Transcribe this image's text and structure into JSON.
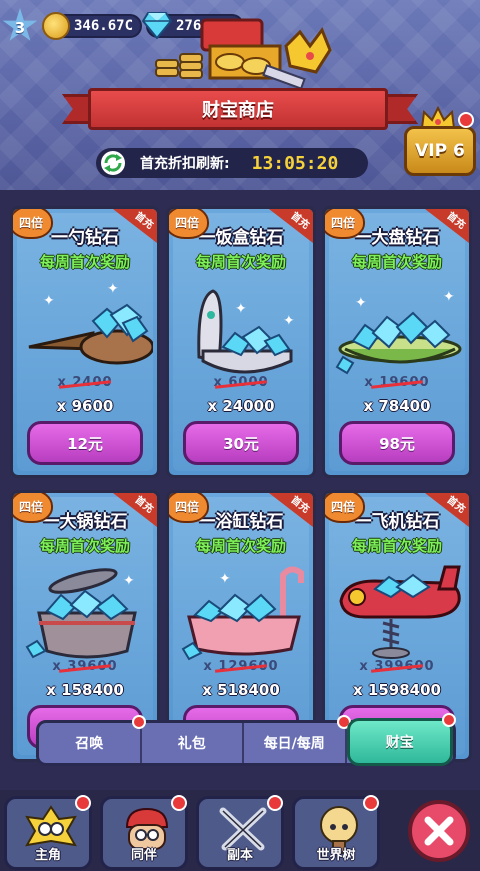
{
  "header": {
    "level": "3",
    "coins": "346.67C",
    "gems": "276092",
    "title": "财宝商店",
    "refresh_label": "首充折扣刷新:",
    "refresh_timer": "13:05:20",
    "vip": "VIP 6"
  },
  "cards": [
    {
      "badge": "四倍",
      "corner": "首充",
      "title": "一勺钻石",
      "subtitle": "每周首次奖励",
      "old": "x 2400",
      "amount": "x 9600",
      "price": "12元",
      "art": "spoon"
    },
    {
      "badge": "四倍",
      "corner": "首充",
      "title": "一饭盒钻石",
      "subtitle": "每周首次奖励",
      "old": "x 6000",
      "amount": "x 24000",
      "price": "30元",
      "art": "lunchbox"
    },
    {
      "badge": "四倍",
      "corner": "首充",
      "title": "一大盘钻石",
      "subtitle": "每周首次奖励",
      "old": "x 19600",
      "amount": "x 78400",
      "price": "98元",
      "art": "plate"
    },
    {
      "badge": "四倍",
      "corner": "首充",
      "title": "一大锅钻石",
      "subtitle": "每周首次奖励",
      "old": "x 39600",
      "amount": "x 158400",
      "price": "",
      "art": "pot"
    },
    {
      "badge": "四倍",
      "corner": "首充",
      "title": "一浴缸钻石",
      "subtitle": "每周首次奖励",
      "old": "x 129600",
      "amount": "x 518400",
      "price": "",
      "art": "bathtub"
    },
    {
      "badge": "四倍",
      "corner": "首充",
      "title": "一飞机钻石",
      "subtitle": "每周首次奖励",
      "old": "x 399600",
      "amount": "x 1598400",
      "price": "",
      "art": "airplane"
    }
  ],
  "tabs": [
    {
      "label": "召唤",
      "active": false
    },
    {
      "label": "礼包",
      "active": false
    },
    {
      "label": "每日/每周",
      "active": false
    },
    {
      "label": "财宝",
      "active": true
    }
  ],
  "nav": [
    {
      "label": "主角",
      "icon": "hero-icon"
    },
    {
      "label": "同伴",
      "icon": "partner-icon"
    },
    {
      "label": "副本",
      "icon": "dungeon-swords-icon"
    },
    {
      "label": "世界树",
      "icon": "world-tree-icon"
    }
  ],
  "colors": {
    "accent_green": "#7ef05a",
    "buy_purple": "#c94ed0",
    "active_tab": "#2fb89a",
    "banner_red": "#d83a3a"
  }
}
